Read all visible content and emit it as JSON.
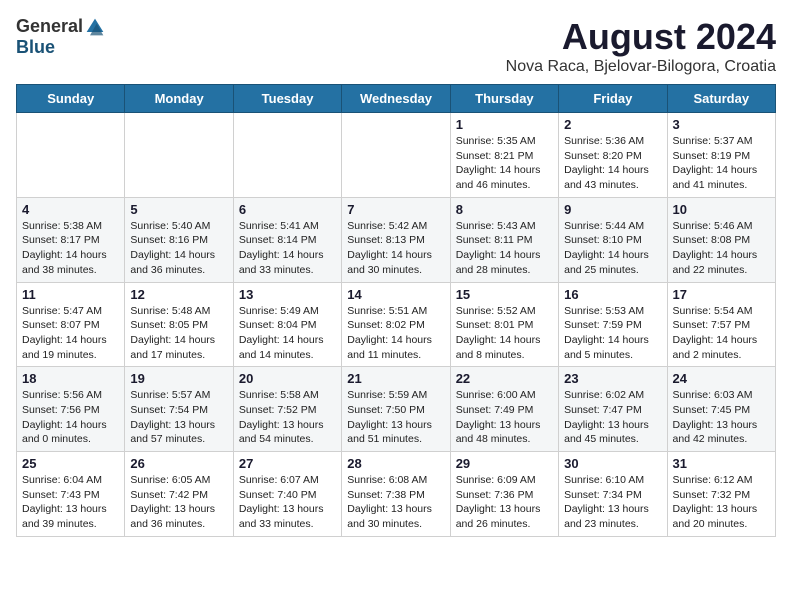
{
  "logo": {
    "general": "General",
    "blue": "Blue"
  },
  "title": "August 2024",
  "subtitle": "Nova Raca, Bjelovar-Bilogora, Croatia",
  "weekdays": [
    "Sunday",
    "Monday",
    "Tuesday",
    "Wednesday",
    "Thursday",
    "Friday",
    "Saturday"
  ],
  "weeks": [
    [
      {
        "day": "",
        "info": ""
      },
      {
        "day": "",
        "info": ""
      },
      {
        "day": "",
        "info": ""
      },
      {
        "day": "",
        "info": ""
      },
      {
        "day": "1",
        "info": "Sunrise: 5:35 AM\nSunset: 8:21 PM\nDaylight: 14 hours\nand 46 minutes."
      },
      {
        "day": "2",
        "info": "Sunrise: 5:36 AM\nSunset: 8:20 PM\nDaylight: 14 hours\nand 43 minutes."
      },
      {
        "day": "3",
        "info": "Sunrise: 5:37 AM\nSunset: 8:19 PM\nDaylight: 14 hours\nand 41 minutes."
      }
    ],
    [
      {
        "day": "4",
        "info": "Sunrise: 5:38 AM\nSunset: 8:17 PM\nDaylight: 14 hours\nand 38 minutes."
      },
      {
        "day": "5",
        "info": "Sunrise: 5:40 AM\nSunset: 8:16 PM\nDaylight: 14 hours\nand 36 minutes."
      },
      {
        "day": "6",
        "info": "Sunrise: 5:41 AM\nSunset: 8:14 PM\nDaylight: 14 hours\nand 33 minutes."
      },
      {
        "day": "7",
        "info": "Sunrise: 5:42 AM\nSunset: 8:13 PM\nDaylight: 14 hours\nand 30 minutes."
      },
      {
        "day": "8",
        "info": "Sunrise: 5:43 AM\nSunset: 8:11 PM\nDaylight: 14 hours\nand 28 minutes."
      },
      {
        "day": "9",
        "info": "Sunrise: 5:44 AM\nSunset: 8:10 PM\nDaylight: 14 hours\nand 25 minutes."
      },
      {
        "day": "10",
        "info": "Sunrise: 5:46 AM\nSunset: 8:08 PM\nDaylight: 14 hours\nand 22 minutes."
      }
    ],
    [
      {
        "day": "11",
        "info": "Sunrise: 5:47 AM\nSunset: 8:07 PM\nDaylight: 14 hours\nand 19 minutes."
      },
      {
        "day": "12",
        "info": "Sunrise: 5:48 AM\nSunset: 8:05 PM\nDaylight: 14 hours\nand 17 minutes."
      },
      {
        "day": "13",
        "info": "Sunrise: 5:49 AM\nSunset: 8:04 PM\nDaylight: 14 hours\nand 14 minutes."
      },
      {
        "day": "14",
        "info": "Sunrise: 5:51 AM\nSunset: 8:02 PM\nDaylight: 14 hours\nand 11 minutes."
      },
      {
        "day": "15",
        "info": "Sunrise: 5:52 AM\nSunset: 8:01 PM\nDaylight: 14 hours\nand 8 minutes."
      },
      {
        "day": "16",
        "info": "Sunrise: 5:53 AM\nSunset: 7:59 PM\nDaylight: 14 hours\nand 5 minutes."
      },
      {
        "day": "17",
        "info": "Sunrise: 5:54 AM\nSunset: 7:57 PM\nDaylight: 14 hours\nand 2 minutes."
      }
    ],
    [
      {
        "day": "18",
        "info": "Sunrise: 5:56 AM\nSunset: 7:56 PM\nDaylight: 14 hours\nand 0 minutes."
      },
      {
        "day": "19",
        "info": "Sunrise: 5:57 AM\nSunset: 7:54 PM\nDaylight: 13 hours\nand 57 minutes."
      },
      {
        "day": "20",
        "info": "Sunrise: 5:58 AM\nSunset: 7:52 PM\nDaylight: 13 hours\nand 54 minutes."
      },
      {
        "day": "21",
        "info": "Sunrise: 5:59 AM\nSunset: 7:50 PM\nDaylight: 13 hours\nand 51 minutes."
      },
      {
        "day": "22",
        "info": "Sunrise: 6:00 AM\nSunset: 7:49 PM\nDaylight: 13 hours\nand 48 minutes."
      },
      {
        "day": "23",
        "info": "Sunrise: 6:02 AM\nSunset: 7:47 PM\nDaylight: 13 hours\nand 45 minutes."
      },
      {
        "day": "24",
        "info": "Sunrise: 6:03 AM\nSunset: 7:45 PM\nDaylight: 13 hours\nand 42 minutes."
      }
    ],
    [
      {
        "day": "25",
        "info": "Sunrise: 6:04 AM\nSunset: 7:43 PM\nDaylight: 13 hours\nand 39 minutes."
      },
      {
        "day": "26",
        "info": "Sunrise: 6:05 AM\nSunset: 7:42 PM\nDaylight: 13 hours\nand 36 minutes."
      },
      {
        "day": "27",
        "info": "Sunrise: 6:07 AM\nSunset: 7:40 PM\nDaylight: 13 hours\nand 33 minutes."
      },
      {
        "day": "28",
        "info": "Sunrise: 6:08 AM\nSunset: 7:38 PM\nDaylight: 13 hours\nand 30 minutes."
      },
      {
        "day": "29",
        "info": "Sunrise: 6:09 AM\nSunset: 7:36 PM\nDaylight: 13 hours\nand 26 minutes."
      },
      {
        "day": "30",
        "info": "Sunrise: 6:10 AM\nSunset: 7:34 PM\nDaylight: 13 hours\nand 23 minutes."
      },
      {
        "day": "31",
        "info": "Sunrise: 6:12 AM\nSunset: 7:32 PM\nDaylight: 13 hours\nand 20 minutes."
      }
    ]
  ]
}
